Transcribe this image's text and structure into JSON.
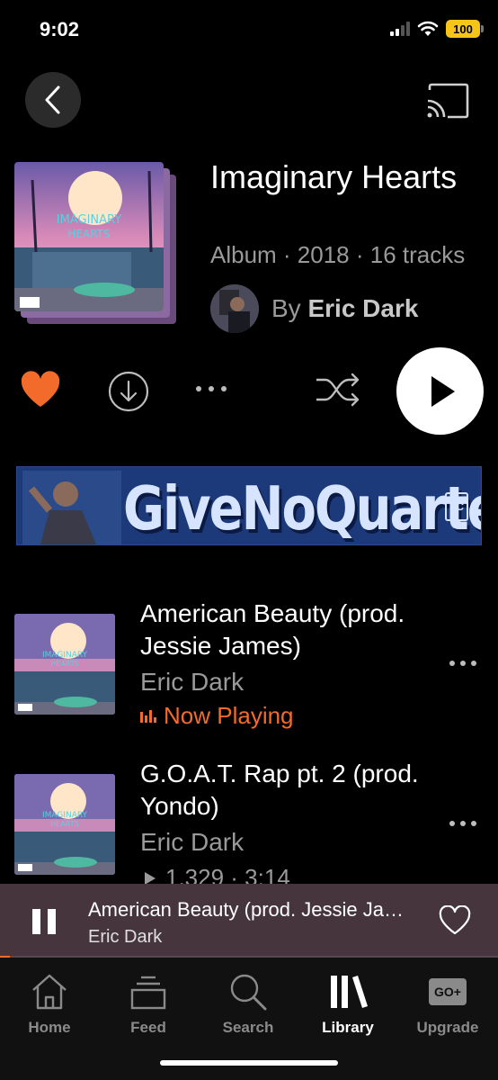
{
  "status_bar": {
    "time": "9:02",
    "battery": "100",
    "icons": [
      "signal-icon",
      "wifi-icon",
      "battery-icon"
    ]
  },
  "header": {
    "back_icon": "chevron-left-icon",
    "cast_icon": "cast-icon"
  },
  "album": {
    "title": "Imaginary Hearts",
    "meta": "Album · 2018 · 16 tracks",
    "by_prefix": "By",
    "artist": "Eric Dark",
    "cover_text": "IMAGINARY HEARTS"
  },
  "actions": {
    "like_icon": "heart-filled-icon",
    "download_icon": "download-icon",
    "more_icon": "more-horizontal-icon",
    "shuffle_icon": "shuffle-icon",
    "play_icon": "play-icon",
    "accent_color": "#f26b2b"
  },
  "banner": {
    "text": "GiveNoQuarter",
    "badge": "LC"
  },
  "tracks": [
    {
      "title": "American Beauty (prod. Jessie James)",
      "artist": "Eric Dark",
      "status": "Now Playing"
    },
    {
      "title": "G.O.A.T. Rap pt. 2 (prod. Yondo)",
      "artist": "Eric Dark",
      "plays": "1,329",
      "duration": "3:14",
      "stats": "1,329 · 3:14"
    }
  ],
  "mini_player": {
    "title": "American Beauty (prod. Jessie James)",
    "artist": "Eric Dark",
    "progress": 0.02
  },
  "tab_bar": {
    "items": [
      {
        "label": "Home",
        "icon": "home-icon"
      },
      {
        "label": "Feed",
        "icon": "feed-icon"
      },
      {
        "label": "Search",
        "icon": "search-icon"
      },
      {
        "label": "Library",
        "icon": "library-icon",
        "active": true
      },
      {
        "label": "Upgrade",
        "icon": "go-plus-icon"
      }
    ],
    "upgrade_badge": "GO+"
  }
}
